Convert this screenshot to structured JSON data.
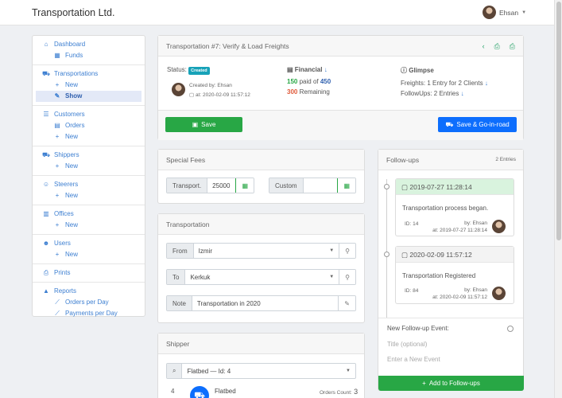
{
  "app": {
    "brand": "Transportation Ltd.",
    "user": "Ehsan"
  },
  "sidebar": {
    "groups": [
      {
        "items": [
          {
            "label": "Dashboard"
          },
          {
            "label": "Funds"
          }
        ]
      },
      {
        "items": [
          {
            "label": "Transportations"
          },
          {
            "label": "New"
          },
          {
            "label": "Show"
          }
        ]
      },
      {
        "items": [
          {
            "label": "Customers"
          },
          {
            "label": "Orders"
          },
          {
            "label": "New"
          }
        ]
      },
      {
        "items": [
          {
            "label": "Shippers"
          },
          {
            "label": "New"
          }
        ]
      },
      {
        "items": [
          {
            "label": "Steerers"
          },
          {
            "label": "New"
          }
        ]
      },
      {
        "items": [
          {
            "label": "Offices"
          },
          {
            "label": "New"
          }
        ]
      },
      {
        "items": [
          {
            "label": "Users"
          },
          {
            "label": "New"
          }
        ]
      },
      {
        "items": [
          {
            "label": "Prints"
          }
        ]
      },
      {
        "items": [
          {
            "label": "Reports"
          },
          {
            "label": "Orders per Day"
          },
          {
            "label": "Payments per Day"
          }
        ]
      }
    ]
  },
  "main": {
    "title": "Transportation #7: Verify & Load Freights",
    "status_label": "Status:",
    "status_badge": "Created",
    "created_by": "Created by: Ehsan",
    "created_at": "at: 2020-02-09 11:57:12",
    "financial_label": "Financial",
    "paid": "150",
    "paid_of": "paid of",
    "total": "450",
    "remaining": "300",
    "remaining_label": "Remaining",
    "glimpse_label": "Glimpse",
    "freights": "Freights: 1 Entry for 2 Clients",
    "followups": "FollowUps: 2 Entries",
    "save": "Save",
    "save_go": "Save & Go-in-road"
  },
  "fees": {
    "title": "Special Fees",
    "transport_label": "Transport.",
    "transport_value": "25000",
    "custom_label": "Custom",
    "custom_value": ""
  },
  "transportation": {
    "title": "Transportation",
    "from_label": "From",
    "from_value": "Izmir",
    "to_label": "To",
    "to_value": "Kerkuk",
    "note_label": "Note",
    "note_value": "Transportation in 2020"
  },
  "shipper": {
    "title": "Shipper",
    "select_value": "Flatbed — Id: 4",
    "row_id": "4",
    "row_name": "Flatbed",
    "orders_label": "Orders Count:",
    "orders_count": "3"
  },
  "followups": {
    "title": "Follow-ups",
    "count": "2 Entries",
    "entries": [
      {
        "date": "2019-07-27 11:28:14",
        "text": "Transportation process began.",
        "id": "ID: 14",
        "by": "by: Ehsan",
        "at": "at: 2019-07-27 11:28:14"
      },
      {
        "date": "2020-02-09 11:57:12",
        "text": "Transportation Registered",
        "id": "ID: 84",
        "by": "by: Ehsan",
        "at": "at: 2020-02-09 11:57:12"
      }
    ],
    "new_label": "New Follow-up Event:",
    "title_placeholder": "Title (optional)",
    "event_placeholder": "Enter a New Event",
    "add_button": "Add to Follow-ups"
  },
  "colors": {
    "green": "#28a745",
    "blue": "#0d6efd",
    "link": "#3d7fd1"
  }
}
